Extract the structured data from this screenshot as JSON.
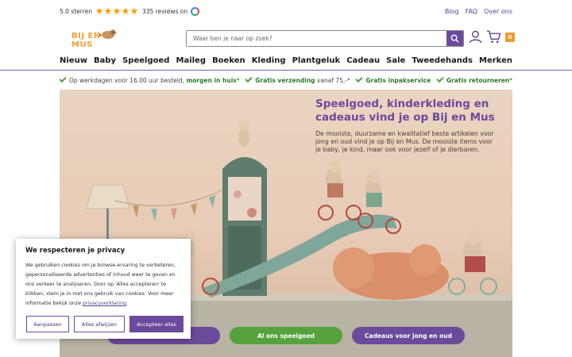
{
  "topbar": {
    "rating_score": "5.0 sterren",
    "rating_value": 5,
    "reviews": "335 reviews on",
    "links": [
      "Blog",
      "FAQ",
      "Over ons"
    ]
  },
  "header": {
    "logo_text": "BIJ EN MUS",
    "search_placeholder": "Waar ben je naar op zoek?",
    "cart_count": "0"
  },
  "nav": [
    "Nieuw",
    "Baby",
    "Speelgoed",
    "Maileg",
    "Boeken",
    "Kleding",
    "Plantgeluk",
    "Cadeau",
    "Sale",
    "Tweedehands",
    "Merken"
  ],
  "usps": [
    {
      "text": "Op werkdagen voor 16.00 uur besteld, ",
      "bold": "morgen in huis",
      "suffix": "*"
    },
    {
      "text": "",
      "bold": "Gratis verzending",
      "suffix": " vanaf 75,-*"
    },
    {
      "text": "",
      "bold": "Gratis inpakservice",
      "suffix": ""
    },
    {
      "text": "",
      "bold": "Gratis retourneren",
      "suffix": "*"
    }
  ],
  "hero": {
    "title": "Speelgoed, kinderkleding en cadeaus vind je op Bij en Mus",
    "text": "De mooiste, duurzame en kwalitatief beste artikelen voor jong en oud vind je op Bij en Mus. De mooiste items voor je baby, je kind, maar ook voor jezelf of je dierbaren.",
    "buttons": [
      "Al ons speelgoed",
      "Cadeaus voor jong en oud"
    ]
  },
  "cookie": {
    "title": "We respecteren je privacy",
    "body": "We gebruiken cookies om je browse-ervaring te verbeteren, gepersonaliseerde advertenties of inhoud weer te geven en ons verkeer te analyseren. Door op 'Alles accepteren' te klikken, stem je in met ons gebruik van cookies. Voor meer informatie bekijk onze ",
    "link": "privacyverklaring",
    "suffix": ".",
    "buttons": {
      "customize": "Aanpassen",
      "reject": "Alles afwijzen",
      "accept": "Accepteer alles"
    }
  },
  "colors": {
    "brand_purple": "#6b4a9c",
    "brand_green": "#56a33d",
    "accent_orange": "#f29a2e"
  }
}
